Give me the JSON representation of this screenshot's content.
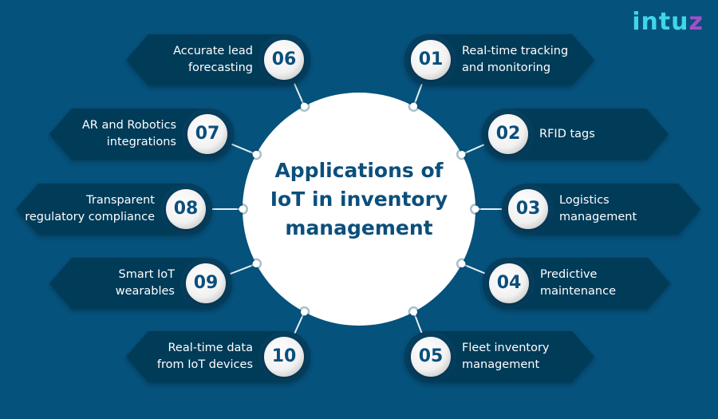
{
  "brand": {
    "logo_main": "intu",
    "logo_accent": "z"
  },
  "center": {
    "title_line1": "Applications of",
    "title_line2": "IoT in inventory",
    "title_line3": "management"
  },
  "colors": {
    "background": "#05527c",
    "card": "#053a58",
    "card_halo": "#063e5e",
    "number_text": "#0b4f7c",
    "title_text": "#0b4f7c",
    "logo": "#3fd6e8",
    "logo_accent": "#a24fc9"
  },
  "items": [
    {
      "number": "01",
      "label": "Real-time tracking\nand monitoring"
    },
    {
      "number": "02",
      "label": "RFID tags"
    },
    {
      "number": "03",
      "label": "Logistics\nmanagement"
    },
    {
      "number": "04",
      "label": "Predictive\nmaintenance"
    },
    {
      "number": "05",
      "label": "Fleet inventory\nmanagement"
    },
    {
      "number": "06",
      "label": "Accurate lead\nforecasting"
    },
    {
      "number": "07",
      "label": "AR and Robotics\nintegrations"
    },
    {
      "number": "08",
      "label": "Transparent\nregulatory compliance"
    },
    {
      "number": "09",
      "label": "Smart IoT\nwearables"
    },
    {
      "number": "10",
      "label": "Real-time data\nfrom IoT devices"
    }
  ]
}
